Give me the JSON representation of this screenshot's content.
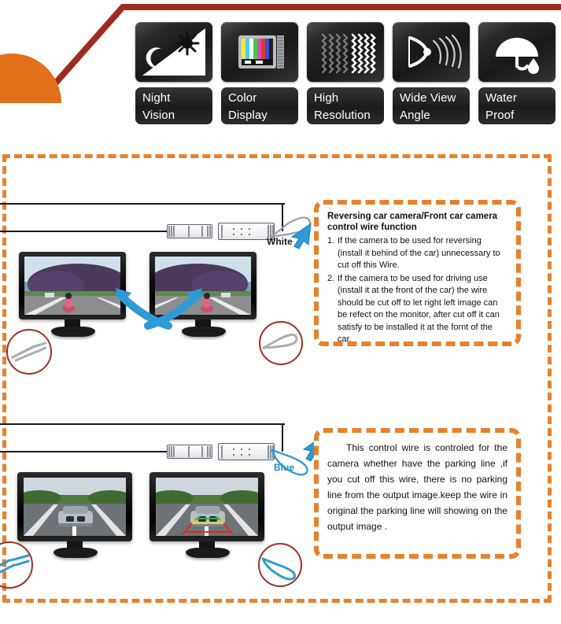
{
  "banner": {
    "accent_red": "#9E2B20",
    "accent_orange": "#E2701A",
    "sun_icon": "sun-arc-icon",
    "features": [
      {
        "icon": "night-vision-icon",
        "line1": "Night",
        "line2": "Vision"
      },
      {
        "icon": "color-display-icon",
        "line1": "Color",
        "line2": "Display"
      },
      {
        "icon": "high-resolution-icon",
        "line1": "High",
        "line2": "Resolution"
      },
      {
        "icon": "wide-view-angle-icon",
        "line1": "Wide View",
        "line2": "Angle"
      },
      {
        "icon": "water-proof-icon",
        "line1": "Water",
        "line2": "Proof"
      }
    ]
  },
  "theme": {
    "dashed_orange": "#E8812B",
    "circle_red": "#9E3024",
    "arrow_blue": "#2E9BD6",
    "wire_blue": "#2E9BD6",
    "wire_gray": "#9AA0A6"
  },
  "section_white": {
    "wire_label": "White",
    "wire_label_color": "#1A1A1A",
    "connector_name": "white-control-wire-connector",
    "left_circle": {
      "name": "cut-wire-callout",
      "state": "cut"
    },
    "right_circle": {
      "name": "intact-wire-callout",
      "state": "intact"
    },
    "monitor_left": {
      "name": "monitor-reversing-view",
      "caption": ""
    },
    "monitor_right": {
      "name": "monitor-mirrored-view",
      "caption": ""
    },
    "textbox": {
      "title": "Reversing car camera/Front car camera control wire function",
      "items": [
        {
          "num": "1.",
          "text": "If the camera to be used for reversing (install it behind of the car) unnecessary to cut off this Wire."
        },
        {
          "num": "2.",
          "text": "If the camera to be used for driving use (install it at the front of the car) the wire should be cut off to let right left image can be refect on the monitor, after cut off it can satisfy to be installed it at the fornt of the car."
        }
      ]
    }
  },
  "section_blue": {
    "wire_label": "Blue",
    "wire_label_color": "#1F8ECF",
    "connector_name": "blue-parking-line-wire-connector",
    "left_circle": {
      "name": "cut-wire-callout",
      "state": "cut"
    },
    "right_circle": {
      "name": "intact-wire-callout",
      "state": "intact"
    },
    "monitor_left": {
      "name": "monitor-no-parking-line",
      "caption": ""
    },
    "monitor_right": {
      "name": "monitor-with-parking-line",
      "caption": ""
    },
    "textbox": {
      "paragraph": "This control wire is controled for the camera whether have the parking line ,if you cut off this wire, there is no parking line from the output image.keep the wire in original the parking line will showing on the output image ."
    }
  }
}
